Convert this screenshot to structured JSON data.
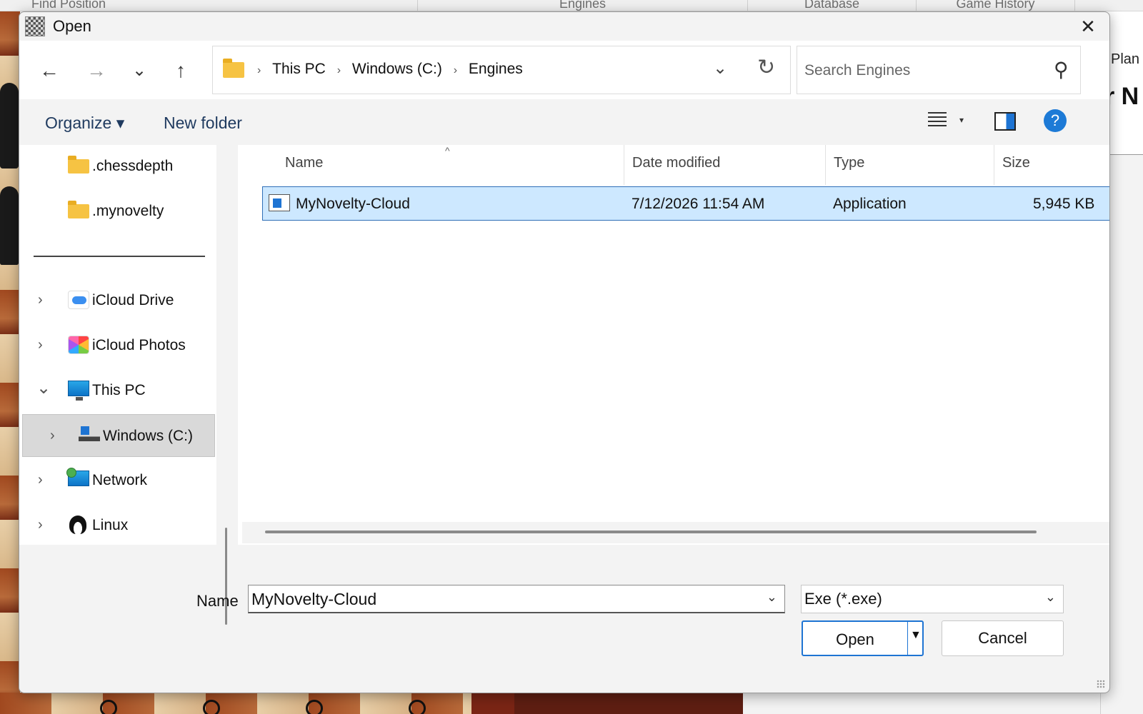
{
  "background": {
    "tabs": [
      "Find Position",
      "Engines",
      "Database",
      "Game History"
    ],
    "right_panel": {
      "line1": "Plan E",
      "line2": "r N"
    }
  },
  "dialog": {
    "title": "Open",
    "close_label": "✕",
    "nav": {
      "back": "←",
      "forward": "→",
      "recent": "⌄",
      "up": "↑"
    },
    "breadcrumb": [
      "This PC",
      "Windows (C:)",
      "Engines"
    ],
    "breadcrumb_separator": "›",
    "address_dropdown": "⌄",
    "refresh": "↻",
    "search_placeholder": "Search Engines",
    "toolbar": {
      "organize": "Organize ▾",
      "new_folder": "New folder",
      "help": "?"
    },
    "sidebar": {
      "quick_items": [
        {
          "label": ".chessdepth",
          "icon": "folder-icon"
        },
        {
          "label": ".mynovelty",
          "icon": "folder-icon"
        }
      ],
      "tree_items": [
        {
          "label": "iCloud Drive",
          "icon": "icloud-drive-icon",
          "expander": "›"
        },
        {
          "label": "iCloud Photos",
          "icon": "icloud-photos-icon",
          "expander": "›"
        },
        {
          "label": "This PC",
          "icon": "this-pc-icon",
          "expander": "⌄"
        },
        {
          "label": "Windows (C:)",
          "icon": "windows-drive-icon",
          "expander": "›",
          "selected": true
        },
        {
          "label": "Network",
          "icon": "network-icon",
          "expander": "›"
        },
        {
          "label": "Linux",
          "icon": "linux-icon",
          "expander": "›"
        }
      ]
    },
    "columns": [
      "Name",
      "Date modified",
      "Type",
      "Size"
    ],
    "sort_indicator": "^",
    "files": [
      {
        "name": "MyNovelty-Cloud",
        "date_modified": "7/12/2026 11:54 AM",
        "type": "Application",
        "size": "5,945 KB",
        "selected": true
      }
    ],
    "footer": {
      "name_label": "Name",
      "name_value": "MyNovelty-Cloud",
      "filter_value": "Exe (*.exe)",
      "open_label": "Open",
      "cancel_label": "Cancel"
    }
  }
}
